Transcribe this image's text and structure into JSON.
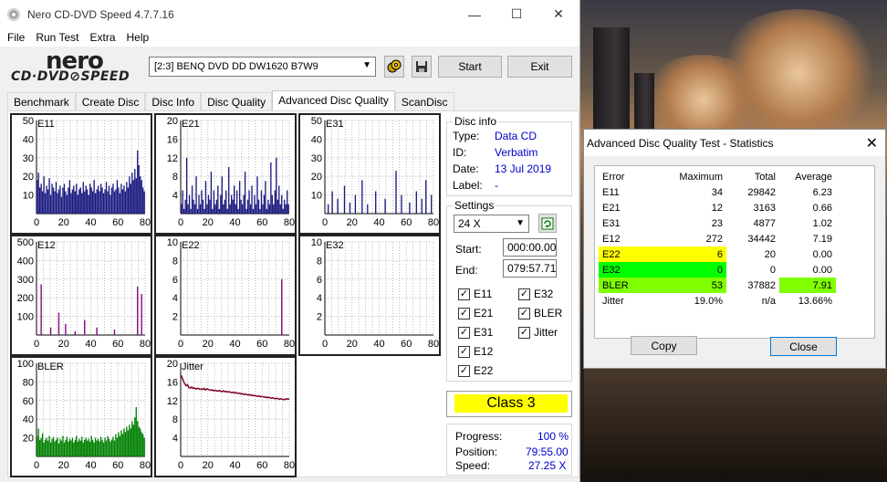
{
  "window": {
    "title": "Nero CD-DVD Speed 4.7.7.16",
    "min": "—",
    "max": "☐",
    "close": "✕"
  },
  "menu": [
    "File",
    "Run Test",
    "Extra",
    "Help"
  ],
  "logo": {
    "line1": "nero",
    "line2": "CD·DVD⊘SPEED"
  },
  "toolbar": {
    "drive": "[2:3]   BENQ DVD DD DW1620 B7W9",
    "start": "Start",
    "exit": "Exit"
  },
  "tabs": [
    "Benchmark",
    "Create Disc",
    "Disc Info",
    "Disc Quality",
    "Advanced Disc Quality",
    "ScanDisc"
  ],
  "disc_info": {
    "title": "Disc info",
    "type_label": "Type:",
    "type": "Data CD",
    "id_label": "ID:",
    "id": "Verbatim",
    "date_label": "Date:",
    "date": "13 Jul 2019",
    "label_label": "Label:",
    "label": "-"
  },
  "settings": {
    "title": "Settings",
    "speed": "24 X",
    "start_label": "Start:",
    "start": "000:00.00",
    "end_label": "End:",
    "end": "079:57.71",
    "checks": [
      {
        "label": "E11",
        "checked": true
      },
      {
        "label": "E32",
        "checked": true
      },
      {
        "label": "E21",
        "checked": true
      },
      {
        "label": "BLER",
        "checked": true
      },
      {
        "label": "E31",
        "checked": true
      },
      {
        "label": "Jitter",
        "checked": true
      },
      {
        "label": "E12",
        "checked": true
      },
      {
        "label": "E22",
        "checked": true
      }
    ]
  },
  "class_label": "Class 3",
  "progress": {
    "progress_label": "Progress:",
    "progress": "100 %",
    "position_label": "Position:",
    "position": "79:55.00",
    "speed_label": "Speed:",
    "speed": "27.25 X"
  },
  "colors": {
    "blue": "#1a1a80",
    "purple": "#800080",
    "green": "#008000",
    "jitter": "#800020",
    "yellow": "#ffff00",
    "lime": "#00ff00"
  },
  "chart_data": [
    {
      "name": "E11",
      "type": "bar",
      "ylim": [
        0,
        50
      ],
      "yticks": [
        10,
        20,
        30,
        40,
        50
      ],
      "xticks": [
        0,
        20,
        40,
        60,
        80
      ],
      "color": "#1a1a80",
      "values": [
        18,
        22,
        14,
        16,
        12,
        20,
        11,
        15,
        13,
        19,
        10,
        16,
        14,
        12,
        17,
        11,
        13,
        15,
        9,
        14,
        16,
        12,
        10,
        14,
        18,
        11,
        13,
        15,
        12,
        16,
        10,
        13,
        14,
        11,
        17,
        12,
        15,
        13,
        10,
        16,
        14,
        12,
        18,
        11,
        13,
        15,
        12,
        16,
        14,
        11,
        13,
        17,
        12,
        15,
        10,
        14,
        16,
        12,
        13,
        18,
        14,
        11,
        16,
        13,
        15,
        12,
        17,
        14,
        20,
        16,
        22,
        18,
        24,
        19,
        34,
        26,
        20,
        18,
        14,
        12
      ]
    },
    {
      "name": "E21",
      "type": "bar",
      "ylim": [
        0,
        20
      ],
      "yticks": [
        4,
        8,
        12,
        16,
        20
      ],
      "xticks": [
        0,
        20,
        40,
        60,
        80
      ],
      "color": "#1a1a80",
      "values": [
        2,
        5,
        1,
        3,
        12,
        2,
        4,
        1,
        6,
        3,
        2,
        8,
        1,
        4,
        2,
        5,
        3,
        1,
        7,
        2,
        4,
        3,
        9,
        1,
        5,
        2,
        3,
        6,
        1,
        4,
        8,
        2,
        3,
        5,
        1,
        10,
        2,
        4,
        3,
        6,
        2,
        5,
        1,
        7,
        3,
        2,
        4,
        9,
        1,
        3,
        5,
        2,
        6,
        1,
        4,
        2,
        8,
        3,
        1,
        5,
        2,
        4,
        7,
        1,
        3,
        2,
        11,
        4,
        2,
        5,
        12,
        3,
        6,
        2,
        4,
        1,
        3,
        2,
        5,
        2
      ]
    },
    {
      "name": "E31",
      "type": "bar",
      "ylim": [
        0,
        50
      ],
      "yticks": [
        10,
        20,
        30,
        40,
        50
      ],
      "xticks": [
        0,
        20,
        40,
        60,
        80
      ],
      "color": "#1a1a80",
      "values": [
        0,
        0,
        5,
        0,
        0,
        12,
        0,
        0,
        0,
        8,
        0,
        0,
        0,
        0,
        15,
        0,
        0,
        0,
        6,
        0,
        0,
        0,
        10,
        0,
        0,
        0,
        0,
        18,
        0,
        0,
        0,
        5,
        0,
        0,
        0,
        0,
        0,
        12,
        0,
        0,
        0,
        0,
        0,
        0,
        8,
        0,
        0,
        0,
        0,
        0,
        0,
        0,
        23,
        0,
        0,
        0,
        10,
        0,
        0,
        0,
        0,
        0,
        6,
        0,
        0,
        0,
        0,
        12,
        0,
        0,
        0,
        8,
        0,
        0,
        18,
        0,
        0,
        0,
        10,
        0
      ]
    },
    {
      "name": "E12",
      "type": "bar",
      "ylim": [
        0,
        500
      ],
      "yticks": [
        100,
        200,
        300,
        400,
        500
      ],
      "xticks": [
        0,
        20,
        40,
        60,
        80
      ],
      "color": "#800080",
      "values": [
        0,
        0,
        0,
        272,
        0,
        0,
        0,
        0,
        0,
        0,
        40,
        0,
        0,
        0,
        0,
        0,
        120,
        0,
        0,
        0,
        0,
        60,
        0,
        0,
        0,
        0,
        0,
        0,
        20,
        0,
        0,
        0,
        0,
        0,
        0,
        80,
        0,
        0,
        0,
        0,
        0,
        0,
        0,
        0,
        40,
        0,
        0,
        0,
        0,
        0,
        0,
        0,
        0,
        0,
        0,
        0,
        0,
        30,
        0,
        0,
        0,
        0,
        0,
        0,
        0,
        0,
        0,
        0,
        0,
        0,
        0,
        0,
        0,
        0,
        260,
        0,
        0,
        220,
        0,
        0
      ]
    },
    {
      "name": "E22",
      "type": "bar",
      "ylim": [
        0,
        10
      ],
      "yticks": [
        2,
        4,
        6,
        8,
        10
      ],
      "xticks": [
        0,
        20,
        40,
        60,
        80
      ],
      "color": "#800080",
      "values": [
        0,
        0,
        0,
        0,
        0,
        0,
        0,
        0,
        0,
        0,
        0,
        0,
        0,
        0,
        0,
        0,
        0,
        0,
        0,
        0,
        0,
        0,
        0,
        0,
        0,
        0,
        0,
        0,
        0,
        0,
        0,
        0,
        0,
        0,
        0,
        0,
        0,
        0,
        0,
        0,
        0,
        0,
        0,
        0,
        0,
        0,
        0,
        0,
        0,
        0,
        0,
        0,
        0,
        0,
        0,
        0,
        0,
        0,
        0,
        0,
        0,
        0,
        0,
        0,
        0,
        0,
        0,
        0,
        0,
        0,
        0,
        0,
        0,
        0,
        6,
        0,
        0,
        0,
        0,
        0
      ]
    },
    {
      "name": "E32",
      "type": "bar",
      "ylim": [
        0,
        10
      ],
      "yticks": [
        2,
        4,
        6,
        8,
        10
      ],
      "xticks": [
        0,
        20,
        40,
        60,
        80
      ],
      "color": "#800080",
      "values": []
    },
    {
      "name": "BLER",
      "type": "bar",
      "ylim": [
        0,
        100
      ],
      "yticks": [
        20,
        40,
        60,
        80,
        100
      ],
      "xticks": [
        0,
        20,
        40,
        60,
        80
      ],
      "color": "#008000",
      "values": [
        22,
        30,
        18,
        20,
        25,
        15,
        18,
        20,
        17,
        22,
        15,
        19,
        21,
        16,
        18,
        20,
        14,
        19,
        17,
        22,
        15,
        18,
        21,
        16,
        19,
        17,
        20,
        15,
        18,
        22,
        16,
        19,
        17,
        21,
        15,
        18,
        20,
        17,
        19,
        16,
        22,
        18,
        15,
        20,
        17,
        19,
        16,
        21,
        18,
        15,
        20,
        17,
        22,
        19,
        16,
        18,
        21,
        17,
        24,
        20,
        26,
        22,
        28,
        24,
        30,
        26,
        32,
        28,
        34,
        30,
        38,
        34,
        42,
        53,
        38,
        32,
        30,
        26,
        24,
        20
      ]
    },
    {
      "name": "Jitter",
      "type": "line",
      "ylim": [
        0,
        20
      ],
      "yticks": [
        4,
        8,
        12,
        16,
        20
      ],
      "xticks": [
        0,
        20,
        40,
        60,
        80
      ],
      "color": "#800020",
      "values": [
        17.5,
        17,
        16.2,
        15.6,
        15.2,
        15.4,
        14.8,
        14.7,
        14.9,
        14.6,
        14.7,
        14.5,
        14.6,
        14.6,
        14.4,
        14.5,
        14.4,
        14.6,
        14.3,
        14.5,
        14.4,
        14.3,
        14.2,
        14.3,
        14.1,
        14.2,
        14.1,
        14.0,
        14.2,
        14.0,
        13.9,
        14.1,
        13.9,
        14.0,
        13.8,
        13.9,
        13.8,
        13.7,
        13.8,
        13.6,
        13.7,
        13.6,
        13.5,
        13.6,
        13.4,
        13.5,
        13.3,
        13.4,
        13.3,
        13.2,
        13.3,
        13.1,
        13.2,
        13.0,
        13.1,
        13.0,
        12.9,
        13.0,
        12.8,
        12.9,
        12.8,
        12.7,
        12.8,
        12.6,
        12.7,
        12.6,
        12.5,
        12.6,
        12.5,
        12.4,
        12.5,
        12.4,
        12.3,
        12.4,
        12.3,
        12.2,
        12.3,
        12.4,
        12.3,
        12.4
      ]
    }
  ],
  "dialog": {
    "title": "Advanced Disc Quality Test - Statistics",
    "headers": [
      "Error",
      "Maximum",
      "Total",
      "Average"
    ],
    "rows": [
      [
        "E11",
        "34",
        "29842",
        "6.23"
      ],
      [
        "E21",
        "12",
        "3163",
        "0.66"
      ],
      [
        "E31",
        "23",
        "4877",
        "1.02"
      ],
      [
        "E12",
        "272",
        "34442",
        "7.19"
      ],
      [
        "E22",
        "6",
        "20",
        "0.00"
      ],
      [
        "E32",
        "0",
        "0",
        "0.00"
      ],
      [
        "BLER",
        "53",
        "37882",
        "7.91"
      ],
      [
        "Jitter",
        "19.0%",
        "n/a",
        "13.66%"
      ]
    ],
    "copy": "Copy",
    "close": "Close"
  }
}
